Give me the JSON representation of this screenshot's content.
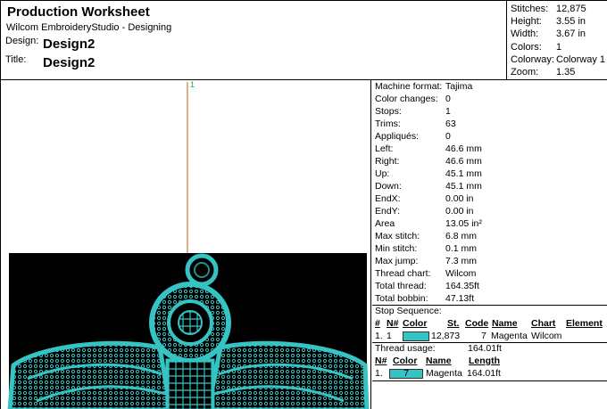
{
  "header": {
    "title": "Production Worksheet",
    "subtitle": "Wilcom EmbroideryStudio - Designing",
    "design_label": "Design:",
    "design_value": "Design2",
    "title_label": "Title:",
    "title_value": "Design2"
  },
  "stats": [
    {
      "k": "Stitches:",
      "v": "12,875"
    },
    {
      "k": "Height:",
      "v": "3.55 in"
    },
    {
      "k": "Width:",
      "v": "3.67 in"
    },
    {
      "k": "Colors:",
      "v": "1"
    },
    {
      "k": "Colorway:",
      "v": "Colorway 1"
    },
    {
      "k": "Zoom:",
      "v": "1.35"
    }
  ],
  "canvas": {
    "marker_label": "1",
    "background_color": "#000000",
    "thread_color": "#35c3c3",
    "marker_color": "#c85a1e",
    "marker_label_color": "#22aa22"
  },
  "info": [
    {
      "k": "Machine format:",
      "v": "Tajima"
    },
    {
      "k": "Color changes:",
      "v": "0"
    },
    {
      "k": "Stops:",
      "v": "1"
    },
    {
      "k": "Trims:",
      "v": "63"
    },
    {
      "k": "Appliqués:",
      "v": "0"
    },
    {
      "k": "Left:",
      "v": "46.6 mm"
    },
    {
      "k": "Right:",
      "v": "46.6 mm"
    },
    {
      "k": "Up:",
      "v": "45.1 mm"
    },
    {
      "k": "Down:",
      "v": "45.1 mm"
    },
    {
      "k": "EndX:",
      "v": "0.00 in"
    },
    {
      "k": "EndY:",
      "v": "0.00 in"
    },
    {
      "k": "Area",
      "v": " 13.05 in²"
    },
    {
      "k": "Max stitch:",
      "v": "6.8 mm"
    },
    {
      "k": "Min stitch:",
      "v": "0.1 mm"
    },
    {
      "k": "Max jump:",
      "v": "7.3 mm"
    },
    {
      "k": "Thread chart:",
      "v": "Wilcom"
    },
    {
      "k": "Total thread:",
      "v": "164.35ft"
    },
    {
      "k": "Total bobbin:",
      "v": "47.13ft"
    }
  ],
  "stop_sequence": {
    "title": "Stop Sequence:",
    "headers": {
      "num": "#",
      "n": "N#",
      "color": "Color",
      "st": "St.",
      "code": "Code",
      "name": "Name",
      "chart": "Chart",
      "element": "Element"
    },
    "row": {
      "num": "1.",
      "n": "1",
      "st": "12,873",
      "code": "7",
      "name": "Magenta",
      "chart": "Wilcom",
      "element": ""
    }
  },
  "thread_usage": {
    "title": "Thread usage:",
    "total": "164.01ft",
    "headers": {
      "n": "N#",
      "color": "Color",
      "name": "Name",
      "length": "Length"
    },
    "row": {
      "n": "1.",
      "code": "7",
      "name": "Magenta",
      "length": "164.01ft"
    }
  }
}
